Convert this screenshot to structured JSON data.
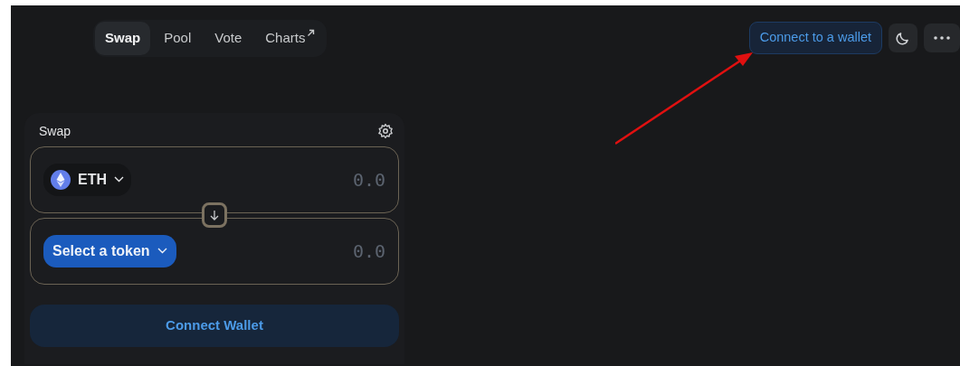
{
  "nav_tabs": [
    {
      "label": "Swap",
      "selected": true,
      "external": false
    },
    {
      "label": "Pool",
      "selected": false,
      "external": false
    },
    {
      "label": "Vote",
      "selected": false,
      "external": false
    },
    {
      "label": "Charts",
      "selected": false,
      "external": true
    }
  ],
  "header": {
    "connect_button": "Connect to a wallet"
  },
  "swap_card": {
    "title": "Swap",
    "inputs": [
      {
        "kind": "token",
        "token": "ETH",
        "placeholder": "0.0"
      },
      {
        "kind": "select",
        "token": "Select a token",
        "placeholder": "0.0"
      }
    ],
    "action_button": "Connect Wallet"
  },
  "annotation": {
    "kind": "arrow"
  }
}
